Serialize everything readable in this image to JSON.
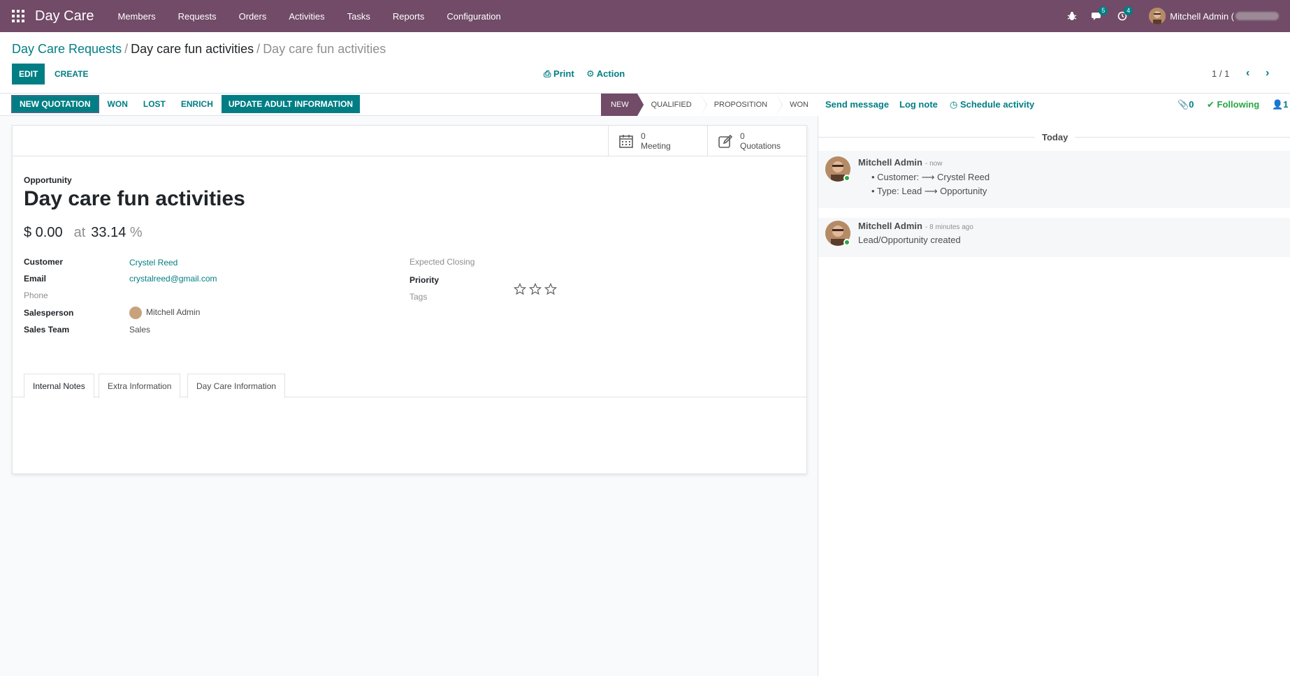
{
  "navbar": {
    "brand": "Day Care",
    "menu": [
      "Members",
      "Requests",
      "Orders",
      "Activities",
      "Tasks",
      "Reports",
      "Configuration"
    ],
    "messages_badge": "5",
    "activities_badge": "4",
    "user_name": "Mitchell Admin ("
  },
  "breadcrumb": {
    "root": "Day Care Requests",
    "middle": "Day care fun activities",
    "current": "Day care fun activities"
  },
  "control": {
    "edit": "EDIT",
    "create": "CREATE",
    "print": "Print",
    "action": "Action",
    "pager": "1 / 1"
  },
  "statusbar": {
    "buttons": [
      "NEW QUOTATION",
      "WON",
      "LOST",
      "ENRICH",
      "UPDATE ADULT INFORMATION"
    ],
    "stages": [
      "NEW",
      "QUALIFIED",
      "PROPOSITION",
      "WON"
    ],
    "active_stage": "NEW"
  },
  "smart_buttons": {
    "meeting_count": "0",
    "meeting_label": "Meeting",
    "quotations_count": "0",
    "quotations_label": "Quotations"
  },
  "form": {
    "type_label": "Opportunity",
    "title": "Day care fun activities",
    "revenue": "$ 0.00",
    "at": "at",
    "probability": "33.14",
    "pct": "%",
    "fields": {
      "customer_label": "Customer",
      "customer": "Crystel Reed",
      "email_label": "Email",
      "email": "crystalreed@gmail.com",
      "phone_label": "Phone",
      "salesperson_label": "Salesperson",
      "salesperson": "Mitchell Admin",
      "team_label": "Sales Team",
      "team": "Sales",
      "closing_label": "Expected Closing",
      "priority_label": "Priority",
      "priority_stars": 0,
      "tags_label": "Tags"
    },
    "tabs": [
      "Internal Notes",
      "Extra Information",
      "Day Care Information"
    ]
  },
  "chatter": {
    "send_message": "Send message",
    "log_note": "Log note",
    "schedule": "Schedule activity",
    "attachments": "0",
    "following": "Following",
    "followers": "1",
    "today": "Today",
    "messages": [
      {
        "author": "Mitchell Admin",
        "date": "- now",
        "lines": [
          "Customer: ⟶ Crystel Reed",
          "Type: Lead ⟶ Opportunity"
        ]
      },
      {
        "author": "Mitchell Admin",
        "date": "- 8 minutes ago",
        "body": "Lead/Opportunity created"
      }
    ]
  },
  "colors": {
    "brand": "#714b67",
    "accent": "#017e84"
  }
}
